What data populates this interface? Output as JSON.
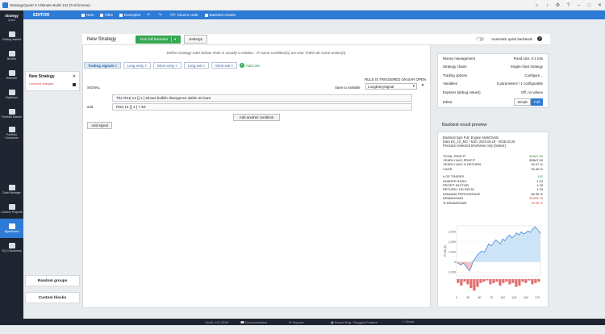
{
  "window": {
    "title": "StrategyQuant X Ultimate Build 142 (Full license)"
  },
  "sidebar": {
    "logo_line1": "Strategy",
    "logo_line2": "Quant",
    "items": [
      {
        "label": "Getting started",
        "icon": "rocket-icon"
      },
      {
        "label": "Builder",
        "icon": "builder-icon"
      },
      {
        "label": "Retester",
        "icon": "retester-icon"
      },
      {
        "label": "Optimizer",
        "icon": "optimizer-icon"
      },
      {
        "label": "Portfolio Master",
        "icon": "portfolio-icon"
      },
      {
        "label": "Portfolio Composer",
        "icon": "composer-icon"
      },
      {
        "label": "Data Manager",
        "icon": "data-icon"
      },
      {
        "label": "Custom Projects",
        "icon": "projects-icon"
      },
      {
        "label": "AlgoWizard",
        "icon": "wand-icon"
      },
      {
        "label": "SQ X Business",
        "icon": "business-icon"
      }
    ]
  },
  "toolbar": {
    "section": "EDITOR",
    "new": "New",
    "files": "Files",
    "examples": "Examples",
    "source_code": "Source code",
    "backtest_results": "Backtest results"
  },
  "strategy_list": {
    "name": "New Strategy",
    "status": "Unsaved changes"
  },
  "side_buttons": {
    "random_groups": "Random groups",
    "custom_blocks": "Custom blocks"
  },
  "header": {
    "strategy_name": "New Strategy",
    "run_button": "Run full backtest",
    "settings": "Settings",
    "auto_backtest": "Automatic quick backtests"
  },
  "description": "Define strategy rules below. Rule is usually a relation - IF some condition(s) are true THEN do some action(s).",
  "tabs": [
    {
      "label": "Trading signals ◊",
      "active": true
    },
    {
      "label": "Long entry ◊",
      "active": false
    },
    {
      "label": "Short entry ◊",
      "active": false
    },
    {
      "label": "Long exit ◊",
      "active": false
    },
    {
      "label": "Short exit ◊",
      "active": false
    }
  ],
  "add_rule": "Add rule",
  "rule": {
    "triggered": "RULE IS TRIGGERED ON BAR OPEN",
    "signal_label": "SIGNAL",
    "save_label": "Save to variable",
    "variable": "LongEntrySignal",
    "and_label": "and",
    "conditions": [
      "The RSI( 14 )[ 1 ] shows bullish divergence within 20 bars",
      "RSI( 14 )[ 1 ] < 50"
    ],
    "add_condition": "Add another condition",
    "add_signal": "Add signal"
  },
  "settings_panel": [
    {
      "label": "Money management",
      "value": "Fixed size, 0.1 lots"
    },
    {
      "label": "Strategy charts",
      "value": "Single-chart strategy"
    },
    {
      "label": "Trading options",
      "value": "Configure..."
    },
    {
      "label": "Variables",
      "value": "5 parameters / 1 configurable"
    },
    {
      "label": "Explorer (debug values)",
      "value": "Off, no values"
    }
  ],
  "editor_mode": {
    "label": "Editor",
    "simple": "Simple",
    "full": "Full",
    "selected": "Full"
  },
  "backtest": {
    "title": "Backtest result preview",
    "info": [
      "Backtest type Full, Engine MultiCharts",
      "Data ES_1S_MC / M10, 2024.06.19 - 2025.02.26",
      "Precision Selected timeframe only (fastest)"
    ],
    "stats_a": [
      {
        "label": "TOTAL PROFIT",
        "value": "$2847.50",
        "color": "g"
      },
      {
        "label": "YEARLY AVG PROFIT",
        "value": "$2847.50",
        "color": ""
      },
      {
        "label": "YEARLY AVG % RETURN",
        "value": "29.47 %",
        "color": ""
      },
      {
        "label": "CAGR",
        "value": "29.46 %",
        "color": ""
      }
    ],
    "stats_b": [
      {
        "label": "# OF TRADES",
        "value": "182",
        "color": "g"
      },
      {
        "label": "SHARPE RATIO",
        "value": "1.22",
        "color": ""
      },
      {
        "label": "PROFIT FACTOR",
        "value": "1.26",
        "color": ""
      },
      {
        "label": "RETURN / DD RATIO",
        "value": "1.93",
        "color": ""
      },
      {
        "label": "WINNING PERCENTAGE",
        "value": "56.35 %",
        "color": ""
      },
      {
        "label": "DRAWDOWN",
        "value": "$1608.75",
        "color": "r"
      },
      {
        "label": "% DRAWDOWN",
        "value": "15.65 %",
        "color": "r"
      }
    ]
  },
  "chart_data": {
    "type": "area",
    "ylabel": "Profit ($)",
    "x_ticks": [
      "0",
      "25",
      "50",
      "75",
      "100",
      "125",
      "150",
      "175"
    ],
    "y_ticks": [
      "-1,000",
      "0",
      "1,000",
      "2,000",
      "3,000"
    ],
    "xlim": [
      0,
      182
    ],
    "ylim": [
      -1400,
      3600
    ],
    "equity": [
      [
        0,
        0
      ],
      [
        5,
        -200
      ],
      [
        10,
        -300
      ],
      [
        15,
        -100
      ],
      [
        20,
        -400
      ],
      [
        25,
        -750
      ],
      [
        28,
        -900
      ],
      [
        32,
        -500
      ],
      [
        36,
        100
      ],
      [
        40,
        300
      ],
      [
        45,
        700
      ],
      [
        50,
        900
      ],
      [
        55,
        1100
      ],
      [
        60,
        950
      ],
      [
        65,
        1400
      ],
      [
        70,
        1800
      ],
      [
        75,
        1600
      ],
      [
        80,
        1900
      ],
      [
        85,
        2200
      ],
      [
        90,
        2000
      ],
      [
        95,
        1800
      ],
      [
        100,
        2300
      ],
      [
        105,
        2100
      ],
      [
        110,
        2500
      ],
      [
        115,
        2700
      ],
      [
        120,
        2400
      ],
      [
        125,
        2600
      ],
      [
        130,
        2900
      ],
      [
        135,
        2700
      ],
      [
        140,
        3000
      ],
      [
        145,
        2800
      ],
      [
        150,
        2900
      ],
      [
        155,
        3100
      ],
      [
        160,
        2950
      ],
      [
        165,
        3300
      ],
      [
        170,
        3500
      ],
      [
        175,
        3300
      ],
      [
        182,
        2847
      ]
    ],
    "drawdown_bars": [
      -300,
      -500,
      -200,
      -400,
      -700,
      -900,
      -600,
      -300,
      -200,
      -100,
      -400,
      -300,
      -200,
      -500,
      -300,
      -200,
      -400,
      -300,
      -600,
      -500,
      -200,
      -300,
      -100,
      -400,
      -300,
      -200
    ]
  }
}
